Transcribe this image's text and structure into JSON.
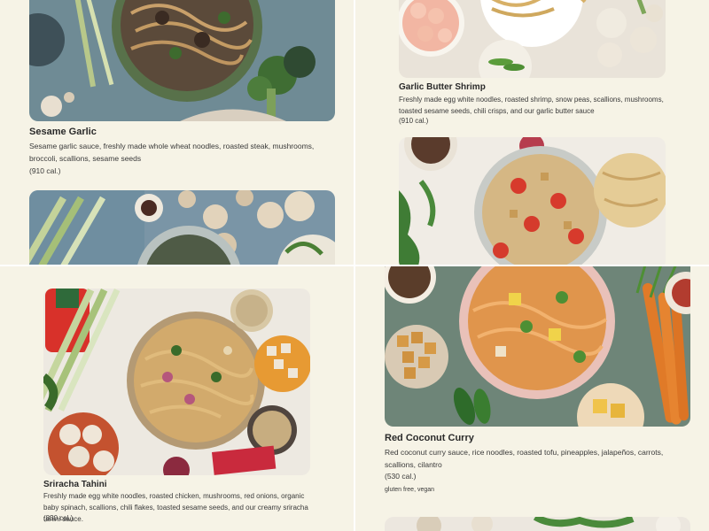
{
  "menu": {
    "sesame_garlic": {
      "title": "Sesame Garlic",
      "description": "Sesame garlic sauce, freshly made whole wheat noodles, roasted steak, mushrooms, broccoli, scallions, sesame seeds",
      "calories": "(910 cal.)"
    },
    "garlic_butter_shrimp": {
      "title": "Garlic Butter Shrimp",
      "description": "Freshly made egg white noodles, roasted shrimp, snow peas, scallions, mushrooms, toasted sesame seeds, chili crisps, and our garlic butter sauce",
      "calories": "(910 cal.)"
    },
    "sriracha_tahini": {
      "title": "Sriracha Tahini",
      "description": "Freshly made egg white noodles, roasted chicken, mushrooms, red onions, organic baby spinach, scallions, chili flakes, toasted sesame seeds, and our creamy sriracha tahini sauce.",
      "calories": "(830 cal.)"
    },
    "red_coconut_curry": {
      "title": "Red Coconut Curry",
      "description": "Red coconut curry sauce, rice noodles, roasted tofu, pineapples, jalapeños, carrots, scallions, cilantro",
      "calories": "(530 cal.)",
      "tags": "gluten free, vegan"
    }
  },
  "colors": {
    "background": "#f6f3e6",
    "divider": "#ffffff",
    "text": "#2a2a2a"
  }
}
